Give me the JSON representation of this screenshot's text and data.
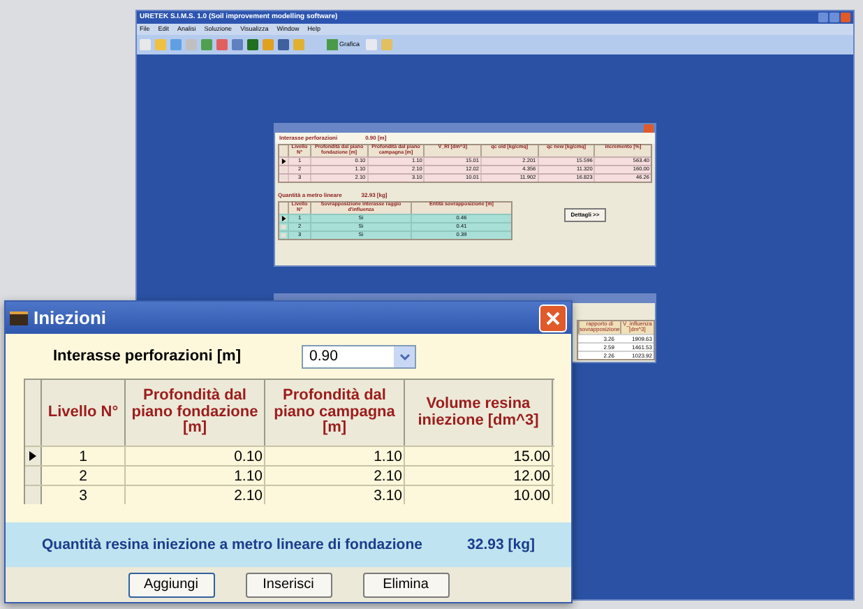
{
  "main_window": {
    "title": "URETEK S.I.M.S. 1.0 (Soil improvement modelling software)",
    "menu": [
      "File",
      "Edit",
      "Analisi",
      "Soluzione",
      "Visualizza",
      "Window",
      "Help"
    ],
    "toolbar_label": "Grafica"
  },
  "results_window": {
    "spacing_label": "Interasse perforazioni",
    "spacing_value": "0.90 [m]",
    "columns": [
      "Livello N°",
      "Profondità dal piano fondazione [m]",
      "Profondità dal piano campagna [m]",
      "V_RI [dm^3]",
      "qc old [kg/cmq]",
      "qc new [kg/cmq]",
      "incremento [%]"
    ],
    "rows": [
      {
        "selected": true,
        "cells": [
          "1",
          "0.10",
          "1.10",
          "15.01",
          "2.201",
          "15.596",
          "563.40"
        ]
      },
      {
        "selected": false,
        "cells": [
          "2",
          "1.10",
          "2.10",
          "12.02",
          "4.356",
          "11.320",
          "160.00"
        ]
      },
      {
        "selected": false,
        "cells": [
          "3",
          "2.10",
          "3.10",
          "10.01",
          "11.902",
          "16.823",
          "46.26"
        ]
      }
    ],
    "quantity_label": "Quantità a metro lineare",
    "quantity_value": "32.93 [kg]",
    "overlap_columns": [
      "Livello N°",
      "Sovrapposizione interasse raggio d'influenza",
      "Entità sovrapposizione [m]"
    ],
    "overlap_rows": [
      {
        "selected": true,
        "cells": [
          "1",
          "Si",
          "0.46"
        ]
      },
      {
        "selected": false,
        "cells": [
          "2",
          "Si",
          "0.41"
        ]
      },
      {
        "selected": false,
        "cells": [
          "3",
          "Si",
          "0.39"
        ]
      }
    ],
    "details_button": "Dettagli >>"
  },
  "second_window": {
    "columns": [
      "rapporto di sovrapposizione",
      "V_influenza [dm^3]"
    ],
    "rows": [
      [
        "3.26",
        "1909.63"
      ],
      [
        "2.59",
        "1461.53"
      ],
      [
        "2.26",
        "1023.92"
      ]
    ]
  },
  "dialog": {
    "title": "Iniezioni",
    "spacing_label": "Interasse perforazioni [m]",
    "spacing_value": "0.90",
    "columns": [
      "Livello N°",
      "Profondità dal piano fondazione [m]",
      "Profondità dal piano campagna [m]",
      "Volume resina iniezione  [dm^3]"
    ],
    "rows": [
      {
        "selected": true,
        "cells": [
          "1",
          "0.10",
          "1.10",
          "15.00"
        ]
      },
      {
        "selected": false,
        "cells": [
          "2",
          "1.10",
          "2.10",
          "12.00"
        ]
      },
      {
        "selected": false,
        "cells": [
          "3",
          "2.10",
          "3.10",
          "10.00"
        ]
      }
    ],
    "total_label": "Quantità resina iniezione a metro lineare di fondazione",
    "total_value": "32.93 [kg]",
    "buttons": [
      "Aggiungi",
      "Inserisci",
      "Elimina"
    ]
  }
}
